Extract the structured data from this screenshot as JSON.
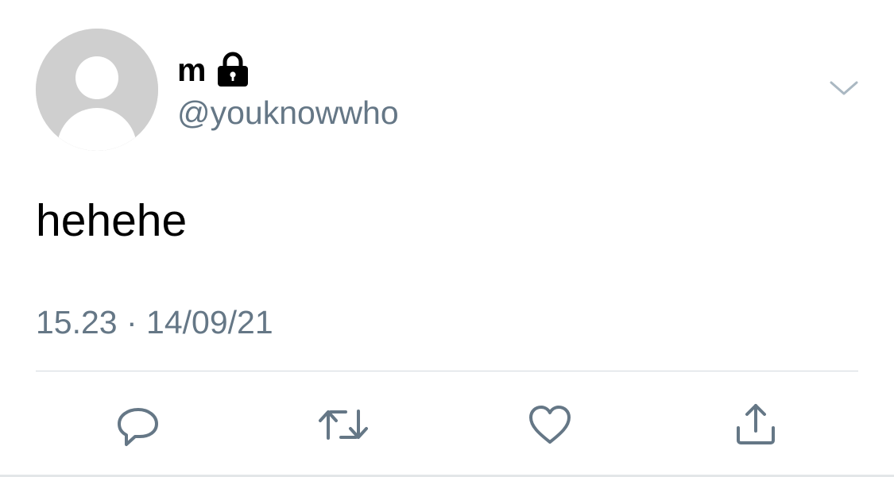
{
  "tweet": {
    "author": {
      "display_name": "m",
      "handle": "@youknowwho",
      "protected": true,
      "avatar": "default-avatar"
    },
    "text": "hehehe",
    "timestamp": "15.23 · 14/09/21",
    "menu_icon": "chevron-down-icon"
  },
  "actions": [
    {
      "name": "reply",
      "icon": "reply-icon"
    },
    {
      "name": "retweet",
      "icon": "retweet-icon"
    },
    {
      "name": "like",
      "icon": "heart-icon"
    },
    {
      "name": "share",
      "icon": "share-icon"
    }
  ],
  "colors": {
    "text": "#000000",
    "secondary_text": "#657786",
    "icon": "#657786",
    "avatar_bg": "#cfcfcf",
    "divider": "#d3d9de"
  }
}
